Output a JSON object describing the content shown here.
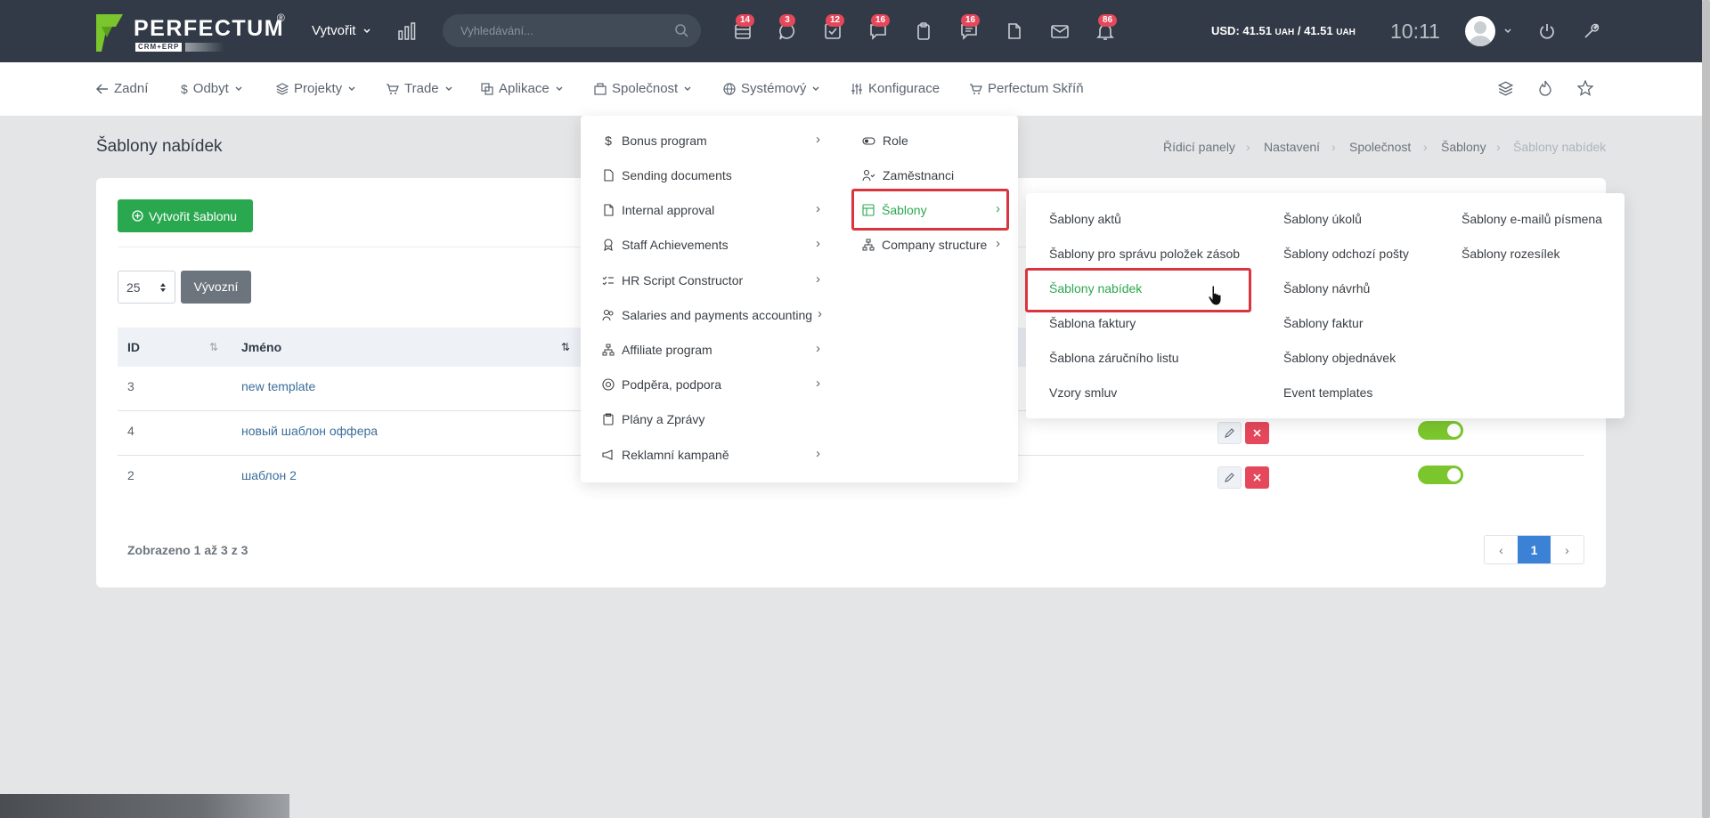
{
  "topbar": {
    "brand": "PERFECTUM",
    "brand_reg": "®",
    "brand_sub": "CRM+ERP",
    "create_label": "Vytvořit",
    "search_placeholder": "Vyhledávání...",
    "badges": [
      "14",
      "3",
      "12",
      "16",
      "16",
      "86"
    ],
    "currency_prefix": "USD: 41.51",
    "currency_unit1": "UAH",
    "currency_mid": "/ 41.51",
    "currency_unit2": "UAH",
    "clock": "10:11"
  },
  "nav": {
    "back": "Zadní",
    "sales": "Odbyt",
    "projects": "Projekty",
    "trade": "Trade",
    "apps": "Aplikace",
    "company": "Společnost",
    "system": "Systémový",
    "config": "Konfigurace",
    "store": "Perfectum Skříň"
  },
  "page": {
    "title": "Šablony nabídek",
    "breadcrumb": [
      "Řídicí panely",
      "Nastavení",
      "Společnost",
      "Šablony",
      "Šablony nabídek"
    ],
    "create_template": "Vytvořit šablonu",
    "page_size": "25",
    "export": "Vývozní",
    "columns": {
      "id": "ID",
      "name": "Jméno"
    },
    "rows": [
      {
        "id": "3",
        "name": "new template"
      },
      {
        "id": "4",
        "name": "новый шаблон оффера"
      },
      {
        "id": "2",
        "name": "шаблон 2"
      }
    ],
    "shown": "Zobrazeno 1 až 3 z 3",
    "pager": {
      "prev": "‹",
      "page": "1",
      "next": "›"
    }
  },
  "dropdown_left": [
    "Bonus program",
    "Sending documents",
    "Internal approval",
    "Staff Achievements",
    "HR Script Constructor",
    "Salaries and payments accounting",
    "Affiliate program",
    "Podpěra, podpora",
    "Plány a Zprávy",
    "Reklamní kampaně"
  ],
  "dropdown_right": [
    "Role",
    "Zaměstnanci",
    "Šablony",
    "Company structure"
  ],
  "submenu": {
    "col1": [
      "Šablony aktů",
      "Šablony pro správu položek zásob",
      "Šablony nabídek",
      "Šablona faktury",
      "Šablona záručního listu",
      "Vzory smluv"
    ],
    "col2": [
      "Šablony úkolů",
      "Šablony odchozí pošty",
      "Šablony návrhů",
      "Šablony faktur",
      "Šablony objednávek",
      "Event templates"
    ],
    "col3": [
      "Šablony e-mailů písmena",
      "Šablony rozesílek"
    ]
  },
  "colors": {
    "topbar": "#313a46",
    "green": "#2aa84f",
    "accent_green_text": "#2aa84f",
    "highlight": "#d9353e",
    "toggle": "#7bc62d",
    "badge": "#e5485a"
  }
}
